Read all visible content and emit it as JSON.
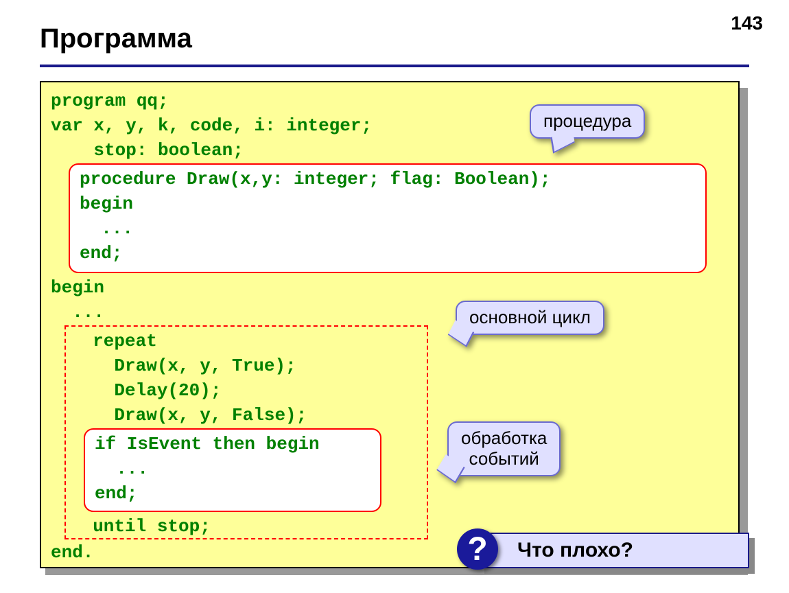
{
  "page_number": "143",
  "title": "Программа",
  "code": {
    "l1": "program qq;",
    "l2": "var x, y, k, code, i: integer;",
    "l3": "    stop: boolean;",
    "l4": "procedure Draw(x,y: integer; flag: Boolean);",
    "l5": "begin",
    "l6": "  ...",
    "l7": "end;",
    "l8": "begin",
    "l9": "  ...",
    "l10": "  repeat",
    "l11": "    Draw(x, y, True);",
    "l12": "    Delay(20);",
    "l13": "    Draw(x, y, False);",
    "l14": "if IsEvent then begin",
    "l15": "  ...",
    "l16": "end;",
    "l17": "  until stop;",
    "l18": "end."
  },
  "callouts": {
    "procedure": "процедура",
    "main_loop": "основной цикл",
    "events": "обработка\nсобытий"
  },
  "question": {
    "symbol": "?",
    "text": "Что плохо?"
  }
}
